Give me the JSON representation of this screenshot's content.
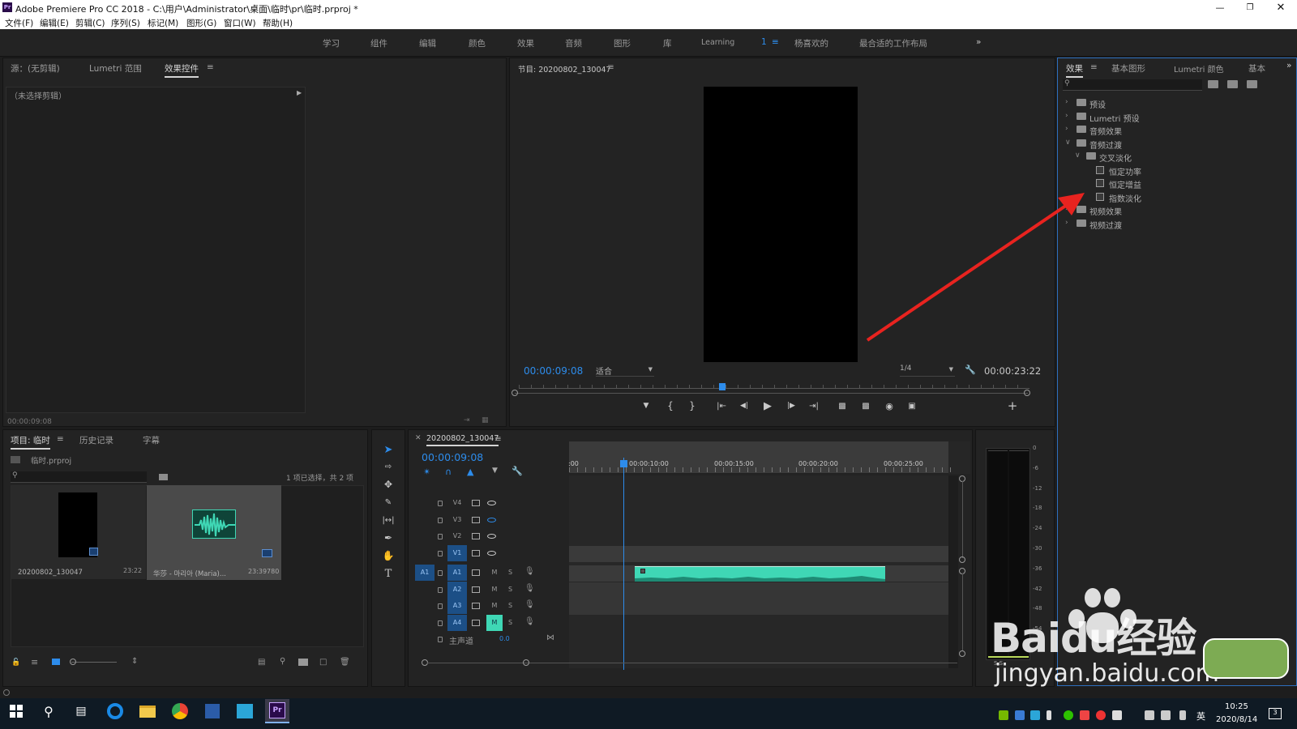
{
  "window": {
    "title": "Adobe Premiere Pro CC 2018 - C:\\用户\\Administrator\\桌面\\临时\\pr\\临时.prproj *",
    "app_icon": "Pr"
  },
  "menu": [
    "文件(F)",
    "编辑(E)",
    "剪辑(C)",
    "序列(S)",
    "标记(M)",
    "图形(G)",
    "窗口(W)",
    "帮助(H)"
  ],
  "workspaces": [
    "学习",
    "组件",
    "编辑",
    "颜色",
    "效果",
    "音频",
    "图形",
    "库",
    "Learning",
    "1",
    "杨喜欢的",
    "最合适的工作布局"
  ],
  "source_panel": {
    "tabs": [
      "源：(无剪辑)",
      "Lumetri 范围",
      "效果控件"
    ],
    "no_clip": "（未选择剪辑）",
    "timecode": "00:00:09:08"
  },
  "program_monitor": {
    "title": "节目: 20200802_130047",
    "timecode": "00:00:09:08",
    "fit": "适合",
    "quality": "1/4",
    "duration": "00:00:23:22"
  },
  "effects_panel": {
    "tabs": [
      "效果",
      "基本图形",
      "Lumetri 颜色",
      "基本"
    ],
    "tree": [
      {
        "label": "预设",
        "level": 0,
        "kind": "folder-special",
        "open": false
      },
      {
        "label": "Lumetri 预设",
        "level": 0,
        "kind": "folder-special",
        "open": false
      },
      {
        "label": "音频效果",
        "level": 0,
        "kind": "folder",
        "open": false
      },
      {
        "label": "音频过渡",
        "level": 0,
        "kind": "folder",
        "open": true
      },
      {
        "label": "交叉淡化",
        "level": 1,
        "kind": "folder",
        "open": true
      },
      {
        "label": "恒定功率",
        "level": 2,
        "kind": "effect"
      },
      {
        "label": "恒定增益",
        "level": 2,
        "kind": "effect"
      },
      {
        "label": "指数淡化",
        "level": 2,
        "kind": "effect"
      },
      {
        "label": "视频效果",
        "level": 0,
        "kind": "folder",
        "open": false
      },
      {
        "label": "视频过渡",
        "level": 0,
        "kind": "folder",
        "open": false
      }
    ]
  },
  "project_panel": {
    "tabs": [
      "项目: 临时",
      "历史记录",
      "字幕"
    ],
    "file": "临时.prproj",
    "selection_info": "1 项已选择，共 2 项",
    "items": [
      {
        "name": "20200802_130047",
        "duration": "23:22"
      },
      {
        "name": "华莎 - 마리아 (Maria)...",
        "duration": "23:39780"
      }
    ]
  },
  "timeline": {
    "sequence": "20200802_130047",
    "timecode": "00:00:09:08",
    "ruler": [
      ":00",
      "00:00:10:00",
      "00:00:15:00",
      "00:00:20:00",
      "00:00:25:00"
    ],
    "video_tracks": [
      "V4",
      "V3",
      "V2",
      "V1"
    ],
    "audio_tracks": [
      "A1",
      "A2",
      "A3",
      "A4"
    ],
    "source_patch": "A1",
    "master": "主声道",
    "master_value": "0.0",
    "track_buttons": {
      "mute": "M",
      "solo": "S"
    }
  },
  "audio_meter": {
    "scale": [
      "0",
      "-6",
      "-12",
      "-18",
      "-24",
      "-30",
      "-36",
      "-42",
      "-48",
      "-54"
    ],
    "solo": "S  S"
  },
  "watermark": {
    "brand": "Baidu经验",
    "url": "jingyan.baidu.com"
  },
  "taskbar": {
    "time": "10:25",
    "date": "2020/8/14",
    "ime": "英",
    "notifications": "3"
  },
  "colors": {
    "accent_blue": "#2d8ceb",
    "audio_clip": "#3fd7b5",
    "arrow_red": "#e8231f"
  }
}
